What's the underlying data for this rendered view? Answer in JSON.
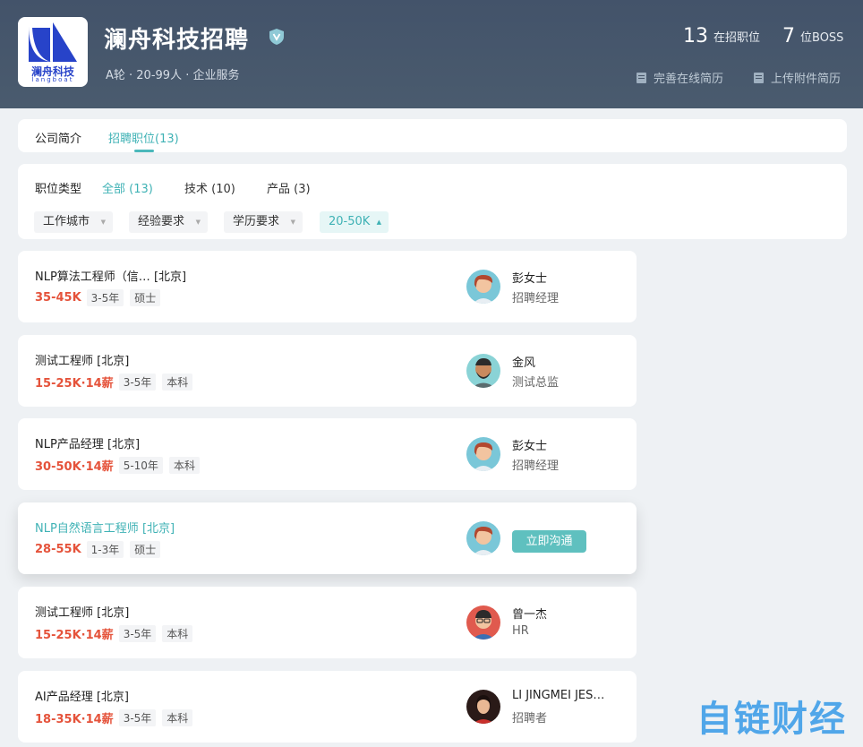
{
  "company": {
    "logo_text_cn": "澜舟科技",
    "logo_text_en": "langboat",
    "name": "澜舟科技招聘",
    "meta": "A轮 · 20-99人 · 企业服务"
  },
  "stats": {
    "jobs_count": "13",
    "jobs_label": "在招职位",
    "boss_count": "7",
    "boss_label": "位BOSS"
  },
  "actions": {
    "online_resume": "完善在线简历",
    "upload_resume": "上传附件简历"
  },
  "tabs": [
    {
      "label": "公司简介"
    },
    {
      "label": "招聘职位(13)"
    }
  ],
  "filters": {
    "type_label": "职位类型",
    "types": [
      {
        "label": "全部 (13)"
      },
      {
        "label": "技术 (10)"
      },
      {
        "label": "产品 (3)"
      }
    ],
    "dropdowns": [
      {
        "label": "工作城市"
      },
      {
        "label": "经验要求"
      },
      {
        "label": "学历要求"
      },
      {
        "label": "20-50K"
      }
    ]
  },
  "jobs": [
    {
      "title": "NLP算法工程师（信…    [北京]",
      "salary": "35-45K",
      "tags": [
        "3-5年",
        "硕士"
      ],
      "recruiter_name": "彭女士",
      "recruiter_role": "招聘经理"
    },
    {
      "title": "测试工程师  [北京]",
      "salary": "15-25K·14薪",
      "tags": [
        "3-5年",
        "本科"
      ],
      "recruiter_name": "金风",
      "recruiter_role": "测试总监"
    },
    {
      "title": "NLP产品经理  [北京]",
      "salary": "30-50K·14薪",
      "tags": [
        "5-10年",
        "本科"
      ],
      "recruiter_name": "彭女士",
      "recruiter_role": "招聘经理"
    },
    {
      "title": "NLP自然语言工程师  [北京]",
      "salary": "28-55K",
      "tags": [
        "1-3年",
        "硕士"
      ],
      "chat_label": "立即沟通"
    },
    {
      "title": "测试工程师  [北京]",
      "salary": "15-25K·14薪",
      "tags": [
        "3-5年",
        "本科"
      ],
      "recruiter_name": "曾一杰",
      "recruiter_role": "HR"
    },
    {
      "title": "AI产品经理  [北京]",
      "salary": "18-35K·14薪",
      "tags": [
        "3-5年",
        "本科"
      ],
      "recruiter_name": "LI JINGMEI JES…",
      "recruiter_role": "招聘者"
    }
  ],
  "watermark": "自链财经",
  "colors": {
    "header_bg": "#475669",
    "accent": "#3fb2b5",
    "salary": "#e5533b",
    "chat_button": "#5fc0bf"
  }
}
